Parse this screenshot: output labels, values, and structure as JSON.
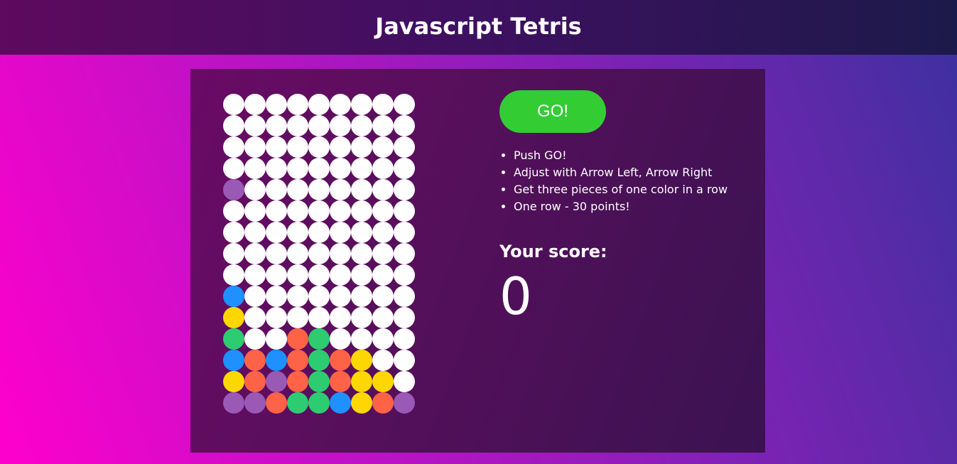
{
  "header": {
    "title": "Javascript Tetris"
  },
  "controls": {
    "go_label": "GO!"
  },
  "instructions": [
    "Push GO!",
    "Adjust with Arrow Left, Arrow Right",
    "Get three pieces of one color in a row",
    "One row - 30 points!"
  ],
  "score": {
    "label": "Your score:",
    "value": "0"
  },
  "colors": {
    "empty": "#ffffff",
    "purple": "#9b59b6",
    "blue": "#1e90ff",
    "yellow": "#ffd700",
    "green": "#2ecc71",
    "red": "#ff6347",
    "go_button": "#33cc33"
  },
  "board": {
    "columns": 9,
    "rows": [
      [
        "empty",
        "empty",
        "empty",
        "empty",
        "empty",
        "empty",
        "empty",
        "empty",
        "empty"
      ],
      [
        "empty",
        "empty",
        "empty",
        "empty",
        "empty",
        "empty",
        "empty",
        "empty",
        "empty"
      ],
      [
        "empty",
        "empty",
        "empty",
        "empty",
        "empty",
        "empty",
        "empty",
        "empty",
        "empty"
      ],
      [
        "empty",
        "empty",
        "empty",
        "empty",
        "empty",
        "empty",
        "empty",
        "empty",
        "empty"
      ],
      [
        "purple",
        "empty",
        "empty",
        "empty",
        "empty",
        "empty",
        "empty",
        "empty",
        "empty"
      ],
      [
        "empty",
        "empty",
        "empty",
        "empty",
        "empty",
        "empty",
        "empty",
        "empty",
        "empty"
      ],
      [
        "empty",
        "empty",
        "empty",
        "empty",
        "empty",
        "empty",
        "empty",
        "empty",
        "empty"
      ],
      [
        "empty",
        "empty",
        "empty",
        "empty",
        "empty",
        "empty",
        "empty",
        "empty",
        "empty"
      ],
      [
        "empty",
        "empty",
        "empty",
        "empty",
        "empty",
        "empty",
        "empty",
        "empty",
        "empty"
      ],
      [
        "blue",
        "empty",
        "empty",
        "empty",
        "empty",
        "empty",
        "empty",
        "empty",
        "empty"
      ],
      [
        "yellow",
        "empty",
        "empty",
        "empty",
        "empty",
        "empty",
        "empty",
        "empty",
        "empty"
      ],
      [
        "green",
        "empty",
        "empty",
        "red",
        "green",
        "empty",
        "empty",
        "empty",
        "empty"
      ],
      [
        "blue",
        "red",
        "blue",
        "red",
        "green",
        "red",
        "yellow",
        "empty",
        "empty"
      ],
      [
        "yellow",
        "red",
        "purple",
        "red",
        "green",
        "red",
        "yellow",
        "yellow",
        "empty"
      ],
      [
        "purple",
        "purple",
        "red",
        "green",
        "green",
        "blue",
        "yellow",
        "red",
        "purple"
      ]
    ]
  }
}
